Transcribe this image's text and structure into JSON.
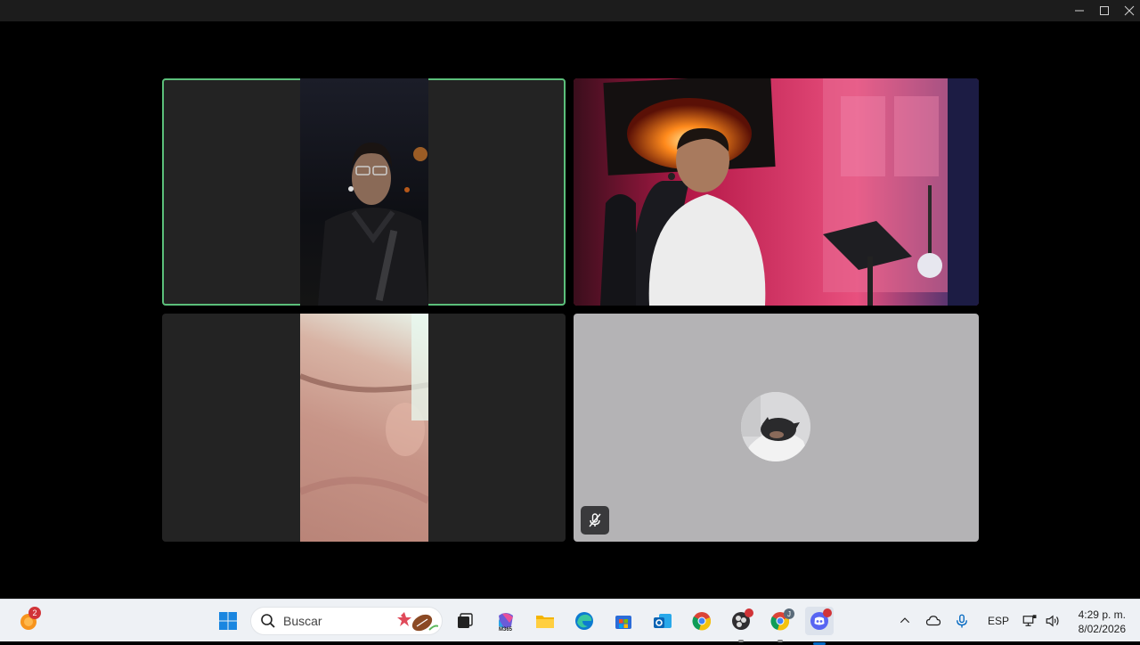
{
  "window": {
    "controls": [
      "minimize-icon",
      "maximize-icon",
      "close-icon"
    ]
  },
  "meeting": {
    "participants": [
      {
        "tile": "top-left",
        "speaking": true,
        "video": true
      },
      {
        "tile": "top-right",
        "speaking": false,
        "video": true
      },
      {
        "tile": "bottom-left",
        "speaking": false,
        "video": true
      },
      {
        "tile": "bottom-right",
        "speaking": false,
        "video": false,
        "muted": true,
        "avatar": true
      }
    ],
    "colors": {
      "speaking_border": "#5bbf7a",
      "avatar_tile_bg": "#b4b3b5"
    }
  },
  "taskbar": {
    "widgets_badge": "2",
    "search_placeholder": "Buscar",
    "pinned": [
      "windows-start-icon",
      "search-icon",
      "task-view-icon",
      "m365-copilot-icon",
      "file-explorer-icon",
      "edge-icon",
      "store-icon",
      "outlook-icon",
      "chrome-icon",
      "obs-icon",
      "chrome-profile-icon",
      "discord-icon"
    ],
    "copilot_label": "M365",
    "chrome_profile_letter": "J",
    "tray": {
      "language": "ESP",
      "time": "4:29 p. m.",
      "date": "8/02/2026"
    }
  }
}
